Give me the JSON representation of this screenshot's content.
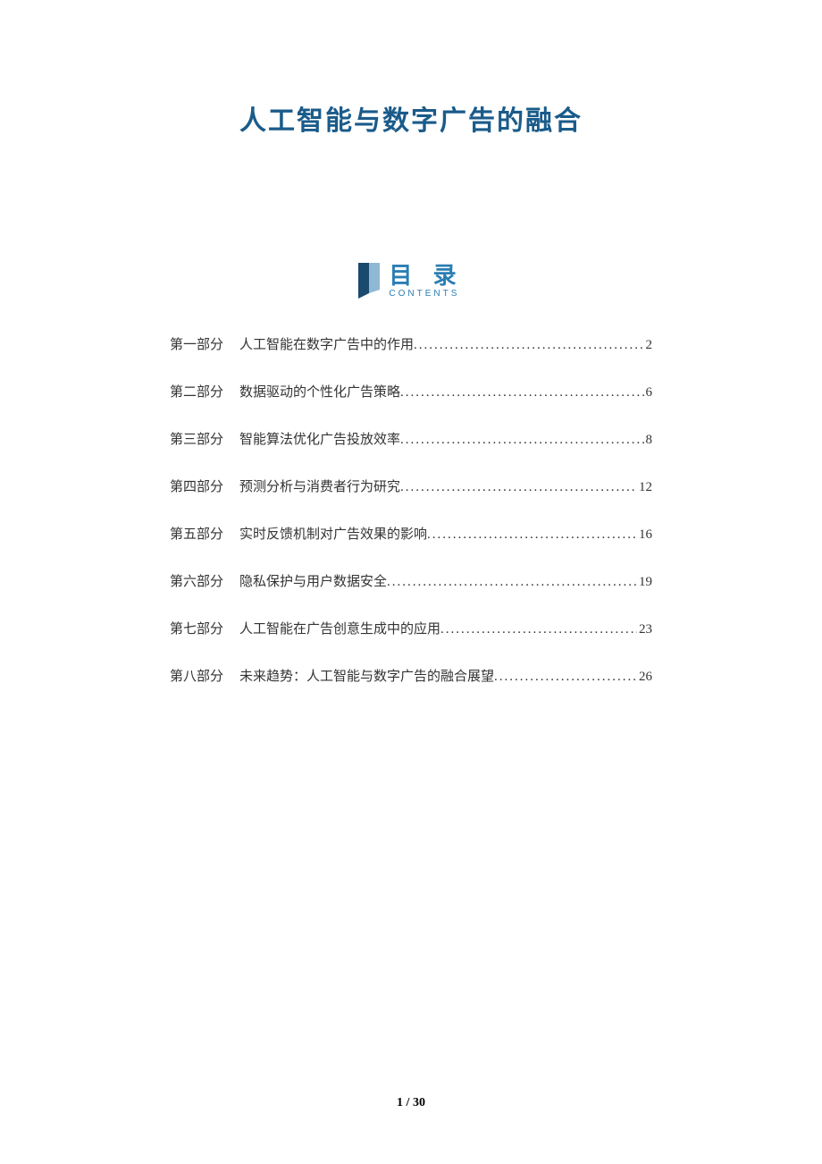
{
  "title": "人工智能与数字广告的融合",
  "toc_header": {
    "main": "目 录",
    "sub": "CONTENTS"
  },
  "toc": [
    {
      "part": "第一部分",
      "chapter": "人工智能在数字广告中的作用",
      "page": "2"
    },
    {
      "part": "第二部分",
      "chapter": "数据驱动的个性化广告策略",
      "page": "6"
    },
    {
      "part": "第三部分",
      "chapter": "智能算法优化广告投放效率",
      "page": "8"
    },
    {
      "part": "第四部分",
      "chapter": "预测分析与消费者行为研究",
      "page": "12"
    },
    {
      "part": "第五部分",
      "chapter": "实时反馈机制对广告效果的影响",
      "page": "16"
    },
    {
      "part": "第六部分",
      "chapter": "隐私保护与用户数据安全",
      "page": "19"
    },
    {
      "part": "第七部分",
      "chapter": "人工智能在广告创意生成中的应用",
      "page": "23"
    },
    {
      "part": "第八部分",
      "chapter": "未来趋势：人工智能与数字广告的融合展望",
      "page": "26"
    }
  ],
  "footer": {
    "current": "1",
    "sep": " / ",
    "total": "30"
  }
}
